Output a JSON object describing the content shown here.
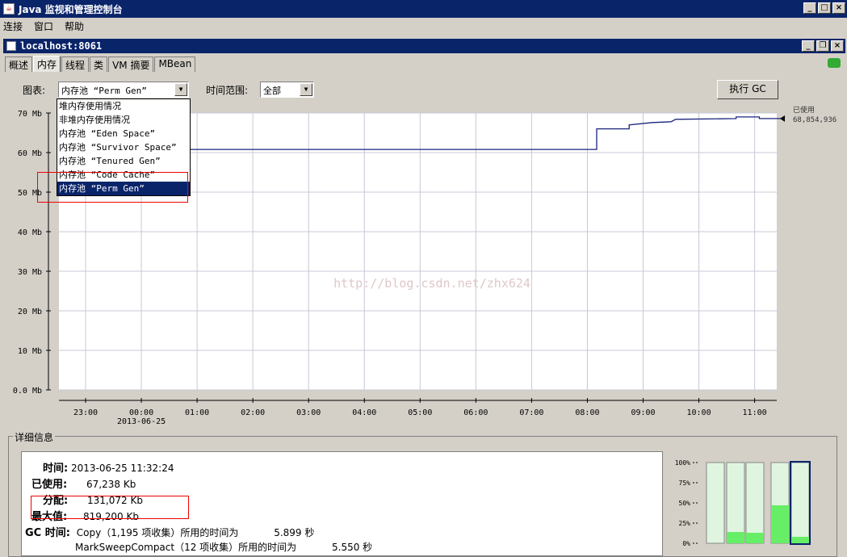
{
  "window": {
    "title": "Java 监视和管理控制台"
  },
  "menu": [
    "连接",
    "窗口",
    "帮助"
  ],
  "connection": {
    "title": "localhost:8061"
  },
  "tabs": [
    "概述",
    "内存",
    "线程",
    "类",
    "VM 摘要",
    "MBean"
  ],
  "active_tab": "内存",
  "controls": {
    "chart_label": "图表:",
    "chart_value": "内存池 “Perm Gen”",
    "time_label": "时间范围:",
    "time_value": "全部",
    "gc_button": "执行 GC"
  },
  "dropdown_options": [
    "堆内存使用情况",
    "非堆内存使用情况",
    "内存池 “Eden Space”",
    "内存池 “Survivor Space”",
    "内存池 “Tenured Gen”",
    "内存池 “Code Cache”",
    "内存池 “Perm Gen”"
  ],
  "dropdown_selected_index": 6,
  "watermark": "http://blog.csdn.net/zhx624",
  "chart_data": {
    "type": "line",
    "y_ticks": [
      "0.0 Mb",
      "10 Mb",
      "20 Mb",
      "30 Mb",
      "40 Mb",
      "50 Mb",
      "60 Mb",
      "70 Mb"
    ],
    "x_ticks": [
      "23:00",
      "00:00",
      "01:00",
      "02:00",
      "03:00",
      "04:00",
      "05:00",
      "06:00",
      "07:00",
      "08:00",
      "09:00",
      "10:00",
      "11:00"
    ],
    "x_date_label": "2013-06-25",
    "ylim_mb": [
      0,
      70
    ],
    "series": [
      {
        "name": "已使用",
        "color": "#1a237e",
        "points": [
          [
            "00:00",
            60.8
          ],
          [
            "08:10",
            60.8
          ],
          [
            "08:10",
            66.0
          ],
          [
            "08:45",
            66.0
          ],
          [
            "08:45",
            67.0
          ],
          [
            "09:10",
            67.6
          ],
          [
            "09:30",
            67.8
          ],
          [
            "09:35",
            68.4
          ],
          [
            "10:40",
            68.6
          ],
          [
            "10:40",
            69.0
          ],
          [
            "11:05",
            69.0
          ],
          [
            "11:05",
            68.6
          ],
          [
            "11:32",
            68.6
          ]
        ]
      }
    ],
    "legend": {
      "label": "已使用",
      "value": "68,854,936"
    }
  },
  "details": {
    "title": "详细信息",
    "time_label": "时间:",
    "time_value": "2013-06-25 11:32:24",
    "used_label": "已使用:",
    "used_value": "67,238 Kb",
    "committed_label": "分配:",
    "committed_value": "131,072 Kb",
    "max_label": "最大值:",
    "max_value": "819,200 Kb",
    "gc_label": "GC 时间:",
    "gc_rows": [
      {
        "text": "Copy（1,195 项收集）所用的时间为",
        "value": "5.899 秒"
      },
      {
        "text": "MarkSweepCompact（12 项收集）所用的时间为",
        "value": "5.550 秒"
      }
    ]
  },
  "bar_chart": {
    "y_ticks": [
      "100%",
      "75%",
      "50%",
      "25%",
      "0%"
    ],
    "bars": [
      0.0,
      0.14,
      0.13,
      0.0,
      0.47,
      0.08
    ]
  }
}
